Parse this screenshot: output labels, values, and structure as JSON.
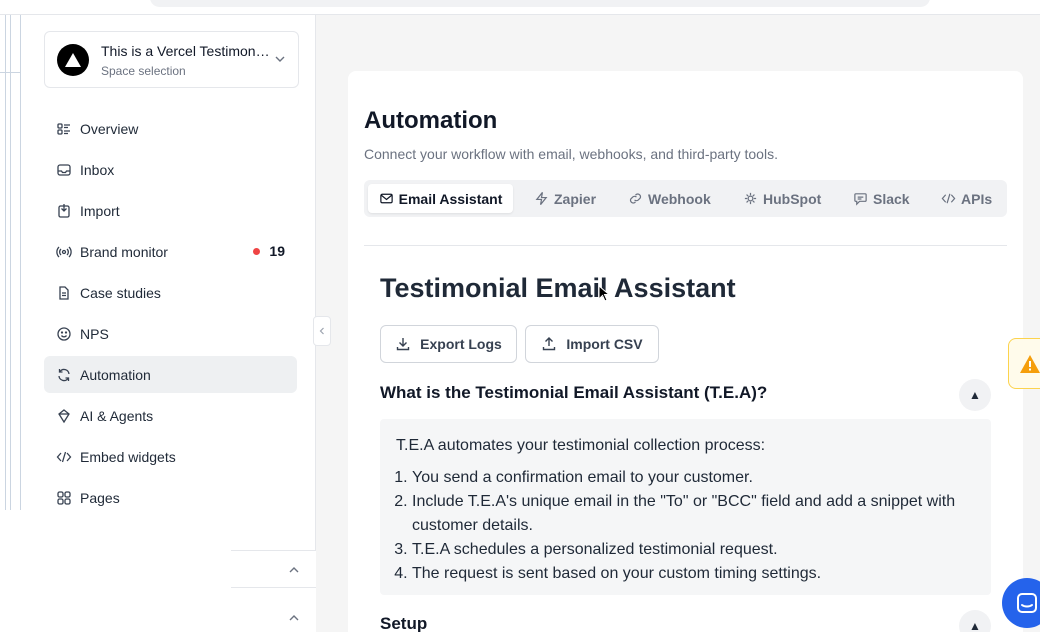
{
  "space": {
    "name": "This is a Vercel Testimonials",
    "subtitle": "Space selection"
  },
  "nav": [
    {
      "label": "Overview",
      "icon": "overview-icon"
    },
    {
      "label": "Inbox",
      "icon": "inbox-icon"
    },
    {
      "label": "Import",
      "icon": "import-icon"
    },
    {
      "label": "Brand monitor",
      "icon": "broadcast-icon",
      "badge": "19"
    },
    {
      "label": "Case studies",
      "icon": "document-icon"
    },
    {
      "label": "NPS",
      "icon": "smiley-icon"
    },
    {
      "label": "Automation",
      "icon": "refresh-icon",
      "active": true
    },
    {
      "label": "AI & Agents",
      "icon": "ai-icon"
    },
    {
      "label": "Embed widgets",
      "icon": "code-icon"
    },
    {
      "label": "Pages",
      "icon": "grid-icon"
    }
  ],
  "page": {
    "title": "Automation",
    "subtitle": "Connect your workflow with email, webhooks, and third-party tools."
  },
  "tabs": [
    {
      "label": "Email Assistant",
      "icon": "mail-icon",
      "active": true
    },
    {
      "label": "Zapier",
      "icon": "zap-icon"
    },
    {
      "label": "Webhook",
      "icon": "link-icon"
    },
    {
      "label": "HubSpot",
      "icon": "hubspot-icon"
    },
    {
      "label": "Slack",
      "icon": "chat-icon"
    },
    {
      "label": "APIs",
      "icon": "code-icon"
    }
  ],
  "section": {
    "title": "Testimonial Email Assistant",
    "export_label": "Export Logs",
    "import_label": "Import CSV",
    "question": "What is the Testimonial Email Assistant (T.E.A)?",
    "toggle_glyph": "▲",
    "intro": "T.E.A automates your testimonial collection process:",
    "steps": [
      "You send a confirmation email to your customer.",
      "Include T.E.A's unique email in the \"To\" or \"BCC\" field and add a snippet with customer details.",
      "T.E.A schedules a personalized testimonial request.",
      "The request is sent based on your custom timing settings."
    ],
    "setup_title": "Setup"
  },
  "colors": {
    "accent": "#2563eb",
    "badge_dot": "#ef4444",
    "warning": "#f59e0b"
  }
}
